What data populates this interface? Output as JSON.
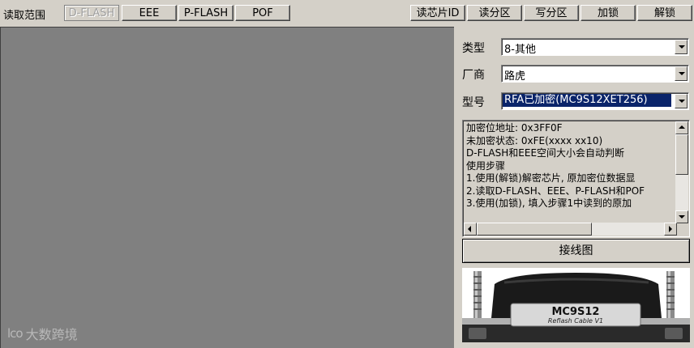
{
  "toolbar": {
    "read_range_label": "读取范围",
    "range_buttons": [
      "D-FLASH",
      "EEE",
      "P-FLASH",
      "POF"
    ],
    "action_buttons": [
      "读芯片ID",
      "读分区",
      "写分区",
      "加锁",
      "解锁"
    ]
  },
  "watermark": {
    "logo": "lco",
    "text": "大数跨境"
  },
  "panel": {
    "type_label": "类型",
    "type_value": "8-其他",
    "vendor_label": "厂商",
    "vendor_value": "路虎",
    "model_label": "型号",
    "model_value": "RFA已加密(MC9S12XET256)",
    "info_lines": [
      "加密位地址: 0x3FF0F",
      "未加密状态: 0xFE(xxxx xx10)",
      "D-FLASH和EEE空间大小会自动判断",
      "使用步骤",
      "1.使用(解锁)解密芯片, 原加密位数据显",
      "2.读取D-FLASH、EEE、P-FLASH和POF",
      "3.使用(加锁), 填入步骤1中读到的原加"
    ],
    "wiring_button": "接线图",
    "cable_image": {
      "title": "MC9S12",
      "subtitle": "Reflash Cable V1"
    }
  },
  "colors": {
    "workspace": "#808080",
    "chrome": "#d4d0c8",
    "selection": "#0a246a"
  }
}
